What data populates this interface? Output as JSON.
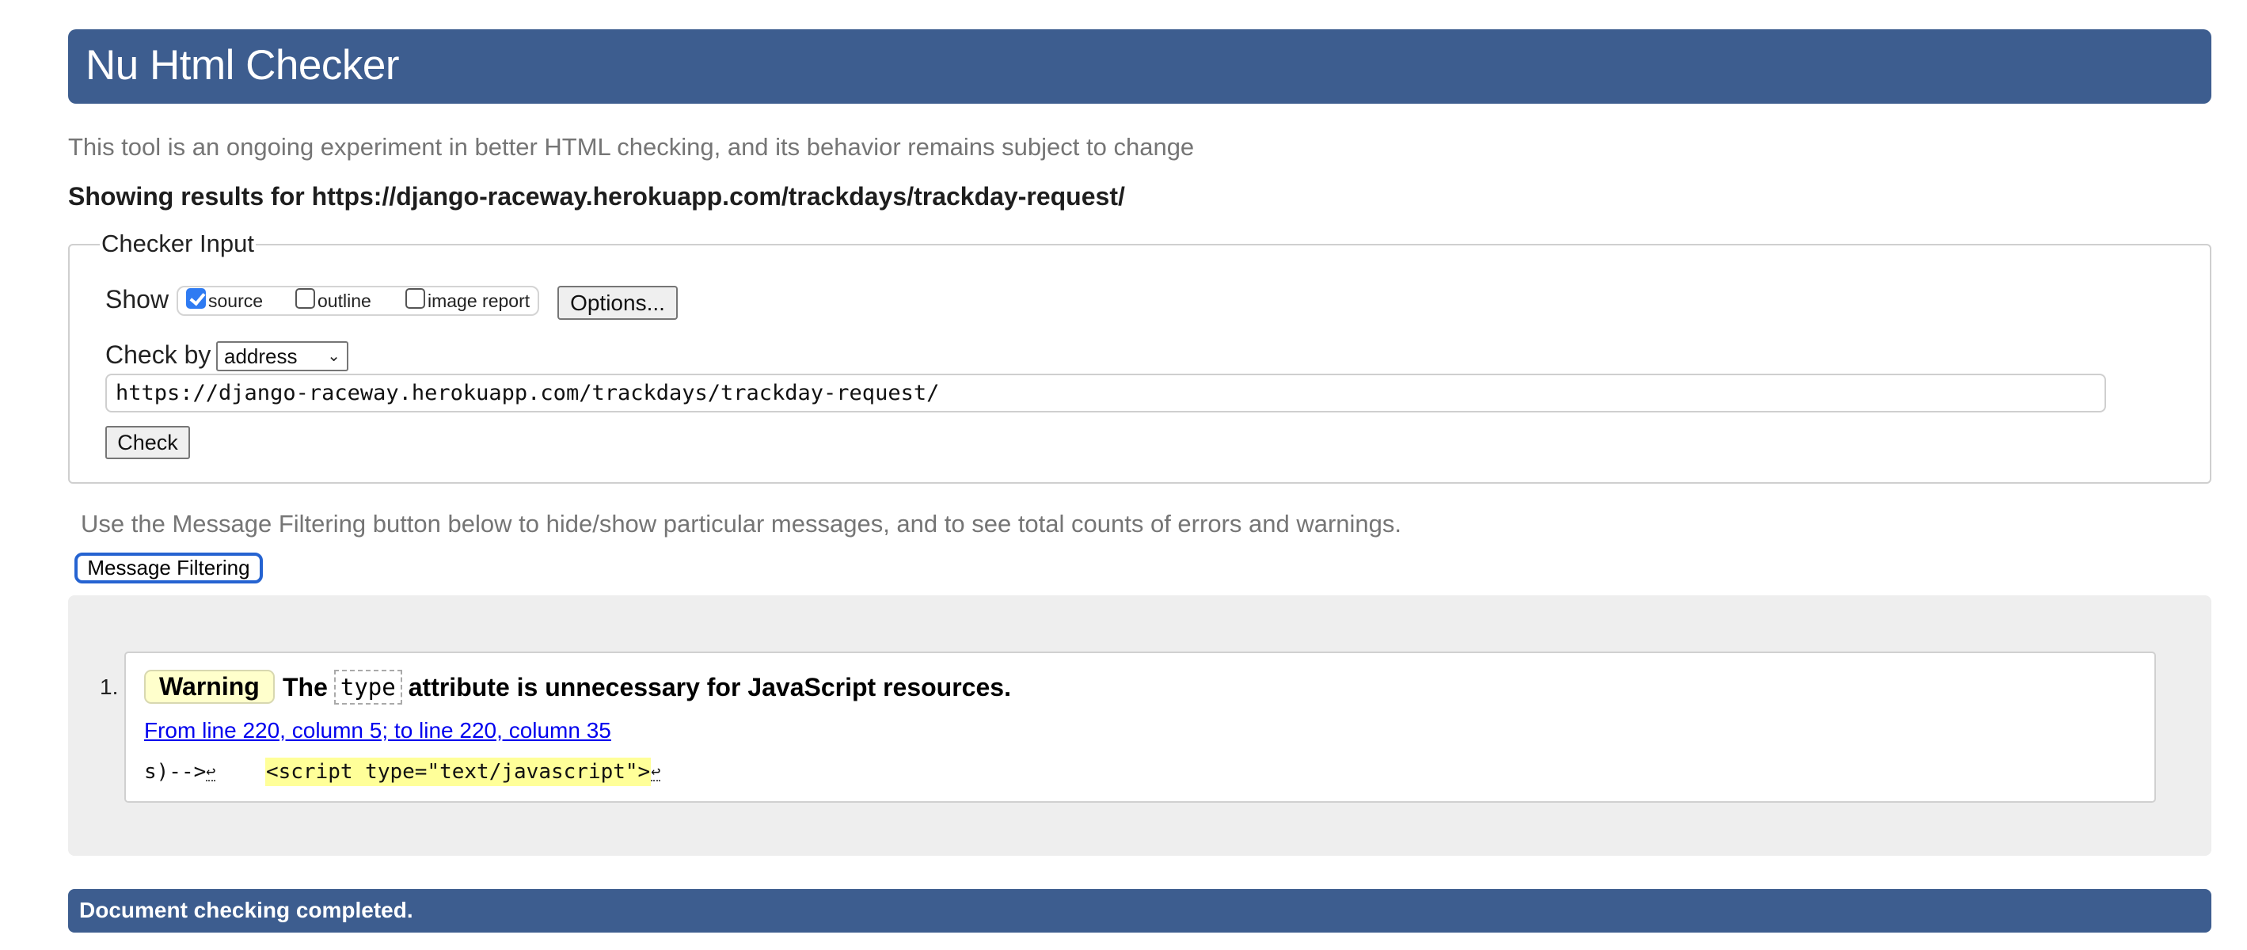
{
  "header": {
    "title": "Nu Html Checker"
  },
  "intro": "This tool is an ongoing experiment in better HTML checking, and its behavior remains subject to change",
  "showing_results": "Showing results for https://django-raceway.herokuapp.com/trackdays/trackday-request/",
  "checker_input": {
    "legend": "Checker Input",
    "show_label": "Show",
    "show_options": [
      {
        "label": "source",
        "checked": true
      },
      {
        "label": "outline",
        "checked": false
      },
      {
        "label": "image report",
        "checked": false
      }
    ],
    "options_button": "Options...",
    "check_by_label": "Check by",
    "check_by_value": "address",
    "url_value": "https://django-raceway.herokuapp.com/trackdays/trackday-request/",
    "check_button": "Check"
  },
  "filtering": {
    "text": "Use the Message Filtering button below to hide/show particular messages, and to see total counts of errors and warnings.",
    "button": "Message Filtering"
  },
  "messages": [
    {
      "number": "1.",
      "type": "Warning",
      "text_before": "The",
      "code": "type",
      "text_after": "attribute is unnecessary for JavaScript resources.",
      "location": "From line 220, column 5; to line 220, column 35",
      "extract_before": "s)-->",
      "extract_highlight": "<script type=\"text/javascript\">",
      "linefeed_symbol": "↩"
    }
  ],
  "footer": {
    "status": "Document checking completed."
  },
  "colors": {
    "brand": "#3d5d8f",
    "warning_bg": "#ffffcc",
    "highlight": "#ffff99",
    "link": "#0000ee"
  }
}
